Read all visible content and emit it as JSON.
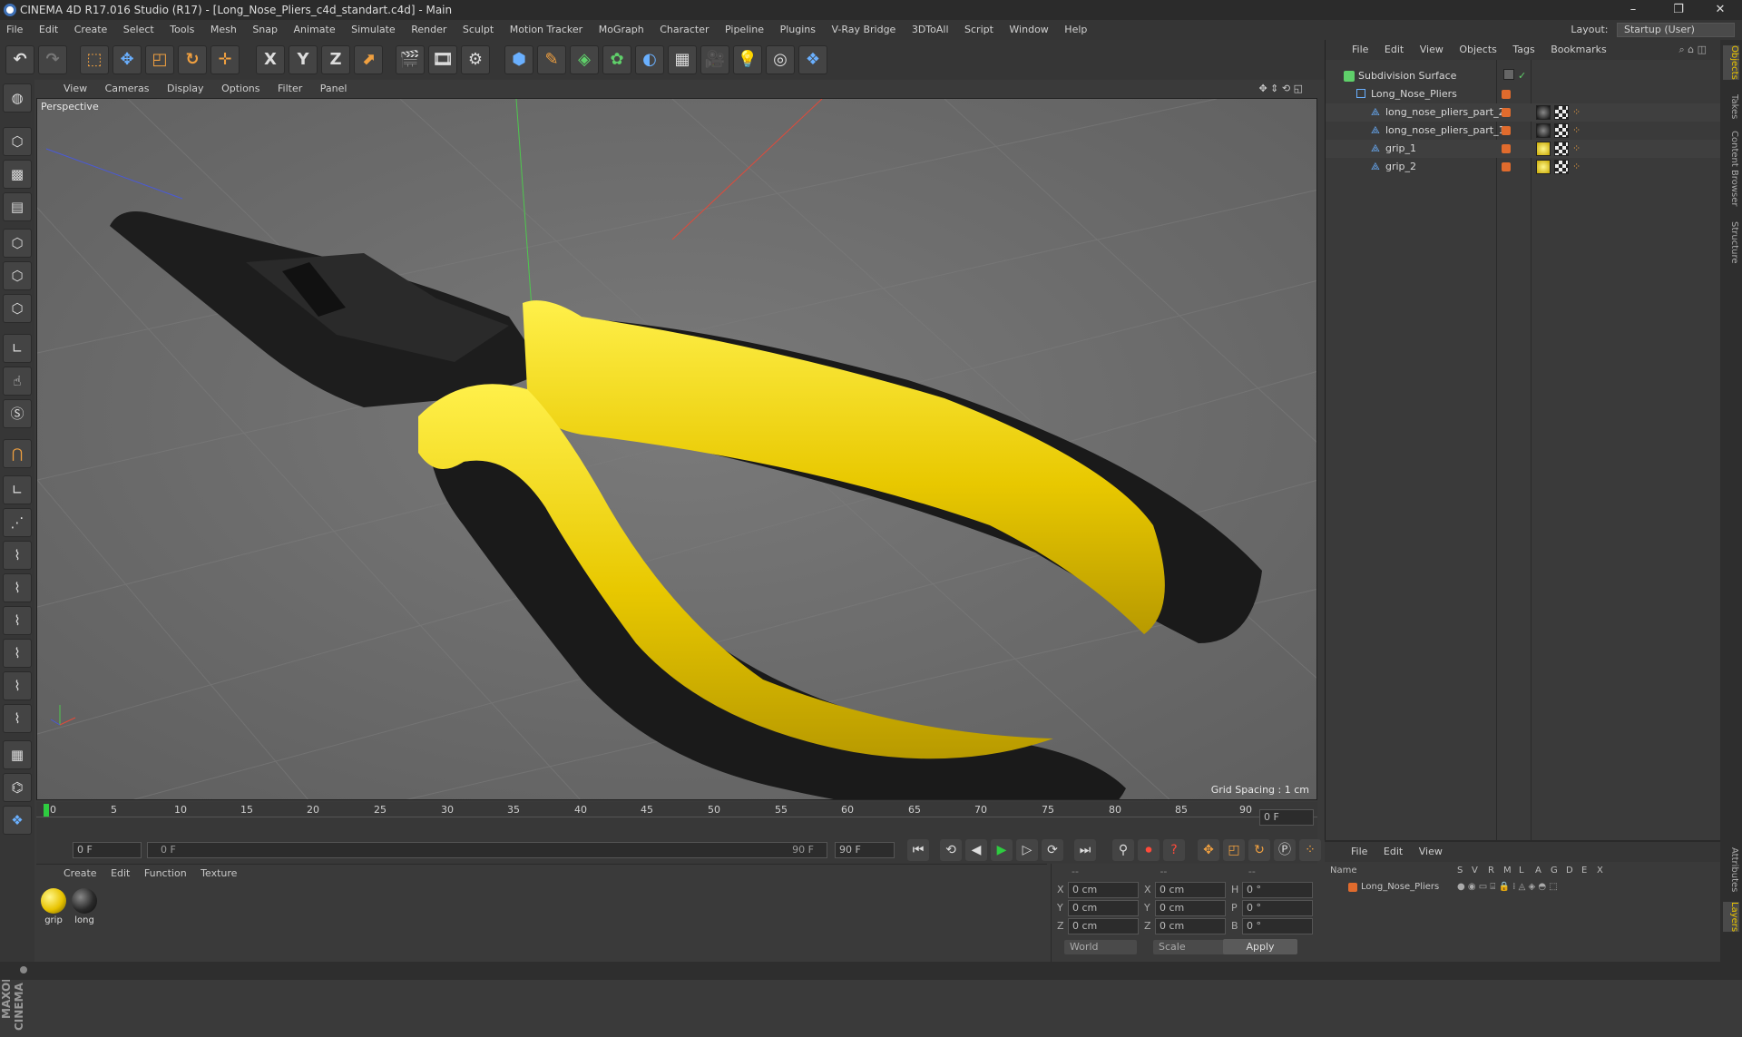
{
  "window": {
    "title": "CINEMA 4D R17.016 Studio (R17) - [Long_Nose_Pliers_c4d_standart.c4d] - Main",
    "minimize": "–",
    "restore": "❐",
    "close": "✕"
  },
  "menu": [
    "File",
    "Edit",
    "Create",
    "Select",
    "Tools",
    "Mesh",
    "Snap",
    "Animate",
    "Simulate",
    "Render",
    "Sculpt",
    "Motion Tracker",
    "MoGraph",
    "Character",
    "Pipeline",
    "Plugins",
    "V-Ray Bridge",
    "3DToAll",
    "Script",
    "Window",
    "Help"
  ],
  "layout": {
    "label": "Layout:",
    "value": "Startup (User)"
  },
  "toolbar": {
    "x": "X",
    "y": "Y",
    "z": "Z"
  },
  "viewport": {
    "menu": [
      "View",
      "Cameras",
      "Display",
      "Options",
      "Filter",
      "Panel"
    ],
    "label": "Perspective",
    "grid_spacing": "Grid Spacing : 1 cm"
  },
  "timeline": {
    "ticks": [
      "0",
      "5",
      "10",
      "15",
      "20",
      "25",
      "30",
      "35",
      "40",
      "45",
      "50",
      "55",
      "60",
      "65",
      "70",
      "75",
      "80",
      "85",
      "90"
    ],
    "current_frame": "0 F",
    "start_field": "0 F",
    "range_start": "0 F",
    "range_end": "90 F",
    "end_field": "90 F"
  },
  "materials": {
    "menu": [
      "Create",
      "Edit",
      "Function",
      "Texture"
    ],
    "items": [
      {
        "label": "grip",
        "color": "#e8c300"
      },
      {
        "label": "long",
        "color": "#2a2a2a"
      }
    ]
  },
  "coords": {
    "header": [
      "--",
      "--",
      "--"
    ],
    "rows": [
      {
        "a": "X",
        "av": "0 cm",
        "b": "X",
        "bv": "0 cm",
        "c": "H",
        "cv": "0 °"
      },
      {
        "a": "Y",
        "av": "0 cm",
        "b": "Y",
        "bv": "0 cm",
        "c": "P",
        "cv": "0 °"
      },
      {
        "a": "Z",
        "av": "0 cm",
        "b": "Z",
        "bv": "0 cm",
        "c": "B",
        "cv": "0 °"
      }
    ],
    "world": "World",
    "scale": "Scale",
    "apply": "Apply"
  },
  "objects": {
    "menu": [
      "File",
      "Edit",
      "View",
      "Objects",
      "Tags",
      "Bookmarks"
    ],
    "items": [
      {
        "name": "Subdivision Surface",
        "level": 0
      },
      {
        "name": "Long_Nose_Pliers",
        "level": 1
      },
      {
        "name": "long_nose_pliers_part_2",
        "level": 2
      },
      {
        "name": "long_nose_pliers_part_1",
        "level": 2
      },
      {
        "name": "grip_1",
        "level": 2
      },
      {
        "name": "grip_2",
        "level": 2
      }
    ]
  },
  "attributes": {
    "menu": [
      "File",
      "Edit",
      "View"
    ],
    "columns": [
      "Name",
      "S",
      "V",
      "R",
      "M",
      "L",
      "A",
      "G",
      "D",
      "E",
      "X"
    ],
    "row": "Long_Nose_Pliers"
  },
  "side_tabs": [
    "Objects",
    "Takes",
    "Content Browser",
    "Structure",
    "Attributes",
    "Layers"
  ],
  "brand": "MAXON CINEMA 4D"
}
